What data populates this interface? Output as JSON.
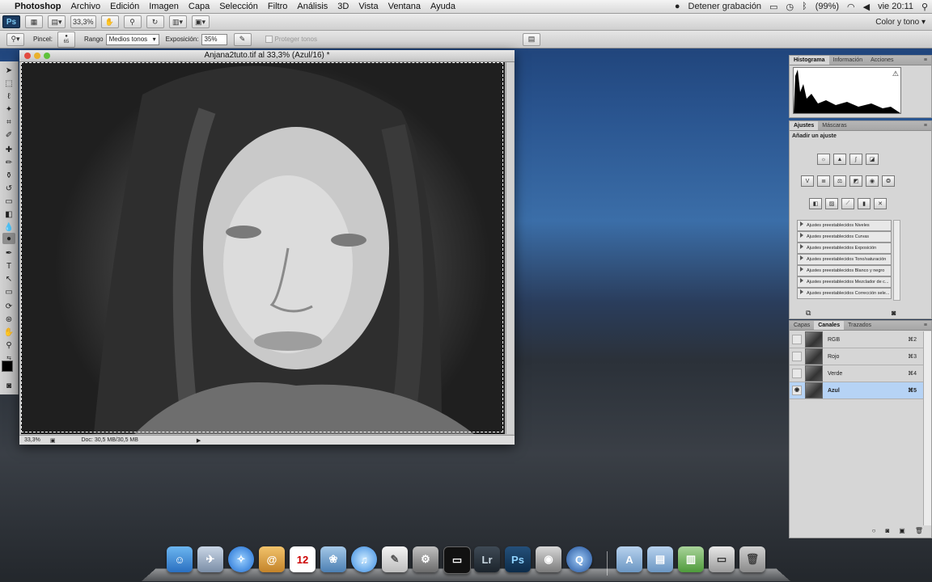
{
  "menubar": {
    "app": "Photoshop",
    "items": [
      "Archivo",
      "Edición",
      "Imagen",
      "Capa",
      "Selección",
      "Filtro",
      "Análisis",
      "3D",
      "Vista",
      "Ventana",
      "Ayuda"
    ],
    "status": {
      "recording": "Detener grabación",
      "battery": "(99%)",
      "clock": "vie 20:11"
    }
  },
  "appbar": {
    "zoom": "33,3%",
    "workspace": "Color y tono"
  },
  "options": {
    "brush_label": "Pincel:",
    "brush_size": "65",
    "range_label": "Rango",
    "range_value": "Medios tonos",
    "exposure_label": "Exposición:",
    "exposure_value": "35%",
    "protect_label": "Proteger tonos"
  },
  "document": {
    "title": "Anjana2tuto.tif al 33,3% (Azul/16) *",
    "zoom": "33,3%",
    "doc_info": "Doc: 30,5 MB/30,5 MB"
  },
  "histogram_panel": {
    "tabs": [
      "Histograma",
      "Información",
      "Acciones"
    ]
  },
  "adjustments_panel": {
    "tabs": [
      "Ajustes",
      "Máscaras"
    ],
    "heading": "Añadir un ajuste",
    "presets": [
      "Ajustes preestablecidos Niveles",
      "Ajustes preestablecidos Curvas",
      "Ajustes preestablecidos Exposición",
      "Ajustes preestablecidos Tono/saturación",
      "Ajustes preestablecidos Blanco y negro",
      "Ajustes preestablecidos Mezclador de c...",
      "Ajustes preestablecidos Corrección sele..."
    ]
  },
  "channels_panel": {
    "tabs": [
      "Capas",
      "Canales",
      "Trazados"
    ],
    "channels": [
      {
        "name": "RGB",
        "key": "⌘2"
      },
      {
        "name": "Rojo",
        "key": "⌘3"
      },
      {
        "name": "Verde",
        "key": "⌘4"
      },
      {
        "name": "Azul",
        "key": "⌘5"
      }
    ]
  },
  "dock": {
    "ps_label": "Ps",
    "lr_label": "Lr",
    "calendar_day": "12"
  }
}
